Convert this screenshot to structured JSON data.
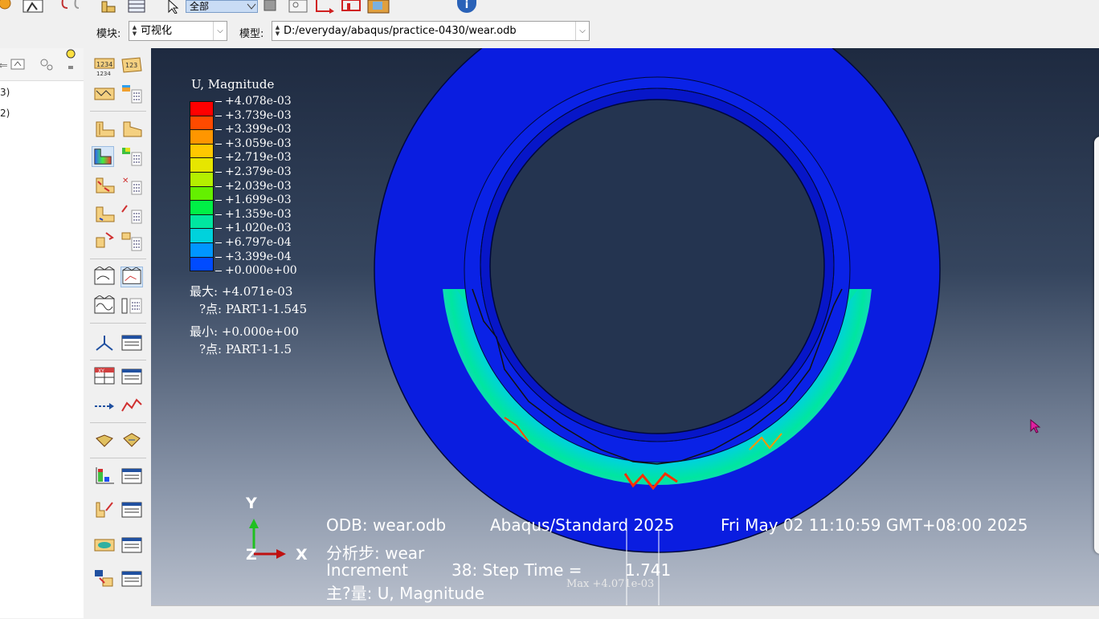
{
  "toolbar": {
    "selection_filter": "全部"
  },
  "context": {
    "module_label": "模块:",
    "module_value": "可视化",
    "model_label": "模型:",
    "model_value": "D:/everyday/abaqus/practice-0430/wear.odb"
  },
  "tree": {
    "rows": [
      "3)",
      "2)"
    ]
  },
  "legend": {
    "title": "U, Magnitude",
    "levels": [
      "+4.078e-03",
      "+3.739e-03",
      "+3.399e-03",
      "+3.059e-03",
      "+2.719e-03",
      "+2.379e-03",
      "+2.039e-03",
      "+1.699e-03",
      "+1.359e-03",
      "+1.020e-03",
      "+6.797e-04",
      "+3.399e-04",
      "+0.000e+00"
    ],
    "colors": [
      "#ff0000",
      "#ff4a00",
      "#ff9600",
      "#ffc800",
      "#e6e600",
      "#b4f000",
      "#64f000",
      "#00f046",
      "#00e6a0",
      "#00d2dc",
      "#0096ff",
      "#004bff",
      "#0000f0"
    ],
    "max_line": "最大: +4.071e-03",
    "max_node": "?点: PART-1-1.545",
    "min_line": "最小: +0.000e+00",
    "min_node": "?点: PART-1-1.5"
  },
  "info": {
    "odb": "ODB: wear.odb",
    "solver": "Abaqus/Standard 2025",
    "datetime": "Fri May 02 11:10:59 GMT+08:00 2025",
    "step": "分析步: wear",
    "increment_label": "Increment",
    "increment_value": "38: Step Time =",
    "step_time": "1.741",
    "primary_var": "主?量: U, Magnitude",
    "max_marker": "Max +4.071e-03"
  },
  "triad": {
    "y": "Y",
    "z": "Z",
    "x": "X"
  }
}
